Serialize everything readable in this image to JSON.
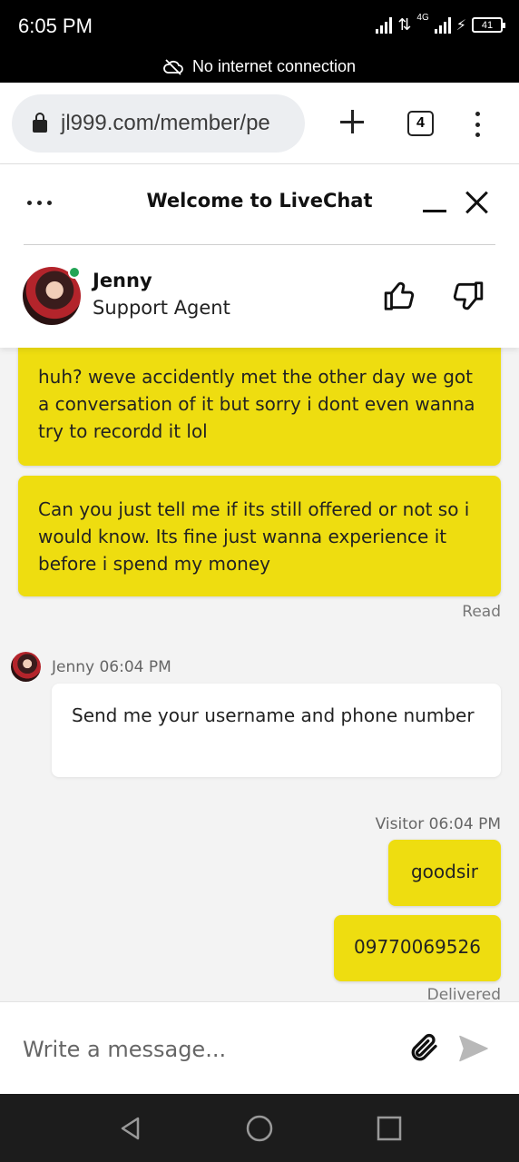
{
  "status_bar": {
    "time": "6:05 PM",
    "network_type": "4G",
    "battery": "41",
    "notice": "No internet connection"
  },
  "browser": {
    "url": "jl999.com/member/pe",
    "tab_count": "4"
  },
  "chat": {
    "title": "Welcome to LiveChat",
    "agent": {
      "name": "Jenny",
      "role": "Support Agent"
    },
    "messages": [
      {
        "text": "huh? weve accidently met the other day we got a conversation of it but sorry i dont even wanna try to recordd it lol"
      },
      {
        "text": "Can you just tell me if its still offered or not so i would know. Its fine just wanna experience it before i spend my money"
      }
    ],
    "read_label": "Read",
    "agent_meta": "Jenny 06:04 PM",
    "agent_message": "Send me your username and phone number",
    "visitor_meta": "Visitor 06:04 PM",
    "visitor_messages": [
      "goodsir",
      "09770069526"
    ],
    "delivered_label": "Delivered"
  },
  "composer": {
    "placeholder": "Write a message..."
  },
  "colors": {
    "visitor_bubble": "#eedd10",
    "online_dot": "#23a455"
  }
}
